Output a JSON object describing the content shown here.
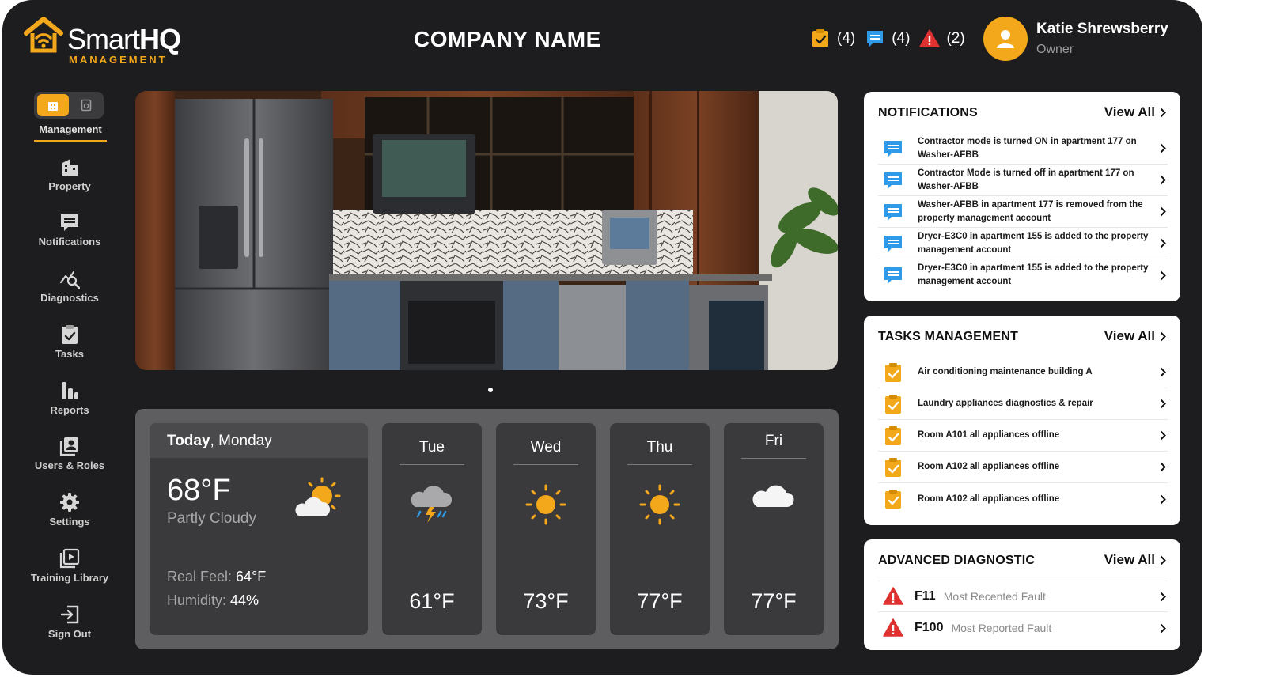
{
  "brand": {
    "word_light": "Smart",
    "word_bold": "HQ",
    "sub": "MANAGEMENT",
    "accent": "#f3a71a"
  },
  "header": {
    "company": "COMPANY NAME",
    "stats": [
      {
        "icon": "task-clipboard-icon",
        "count": "(4)"
      },
      {
        "icon": "message-icon",
        "count": "(4)"
      },
      {
        "icon": "warning-icon",
        "count": "(2)"
      }
    ],
    "user": {
      "name": "Katie Shrewsberry",
      "role": "Owner"
    }
  },
  "sidebar": {
    "active": "Management",
    "items": [
      {
        "label": "Property",
        "icon": "building-icon"
      },
      {
        "label": "Notifications",
        "icon": "notification-icon"
      },
      {
        "label": "Diagnostics",
        "icon": "diagnostics-icon"
      },
      {
        "label": "Tasks",
        "icon": "tasks-icon"
      },
      {
        "label": "Reports",
        "icon": "reports-icon"
      },
      {
        "label": "Users & Roles",
        "icon": "users-icon"
      },
      {
        "label": "Settings",
        "icon": "settings-icon"
      },
      {
        "label": "Training Library",
        "icon": "training-icon"
      },
      {
        "label": "Sign Out",
        "icon": "sign-out-icon"
      }
    ]
  },
  "weather": {
    "today": {
      "day_bold": "Today",
      "day_rest": ", Monday",
      "temp": "68°F",
      "condition": "Partly Cloudy",
      "feel_label": "Real Feel: ",
      "feel_value": "64°F",
      "humidity_label": "Humidity: ",
      "humidity_value": "44%"
    },
    "days": [
      {
        "name": "Tue",
        "temp": "61°F",
        "icon": "storm-icon"
      },
      {
        "name": "Wed",
        "temp": "73°F",
        "icon": "sun-icon"
      },
      {
        "name": "Thu",
        "temp": "77°F",
        "icon": "sun-icon"
      },
      {
        "name": "Fri",
        "temp": "77°F",
        "icon": "cloud-icon"
      }
    ]
  },
  "notifications": {
    "title": "NOTIFICATIONS",
    "view_all": "View All",
    "items": [
      "Contractor mode is turned ON in apartment 177 on Washer-AFBB",
      "Contractor Mode is turned off in apartment 177 on Washer-AFBB",
      "Washer-AFBB in apartment 177 is removed from the property management account",
      "Dryer-E3C0 in apartment 155 is added to the property management account",
      "Dryer-E3C0 in apartment 155 is added to the property management account"
    ]
  },
  "tasks": {
    "title": "TASKS MANAGEMENT",
    "view_all": "View All",
    "items": [
      "Air conditioning maintenance building A",
      "Laundry appliances diagnostics & repair",
      "Room A101 all appliances offline",
      "Room A102 all appliances offline",
      "Room A102 all appliances offline"
    ]
  },
  "diagnostic": {
    "title": "ADVANCED DIAGNOSTIC",
    "view_all": "View All",
    "items": [
      {
        "code": "F11",
        "desc": "Most Recented Fault"
      },
      {
        "code": "F100",
        "desc": "Most Reported Fault"
      }
    ]
  }
}
